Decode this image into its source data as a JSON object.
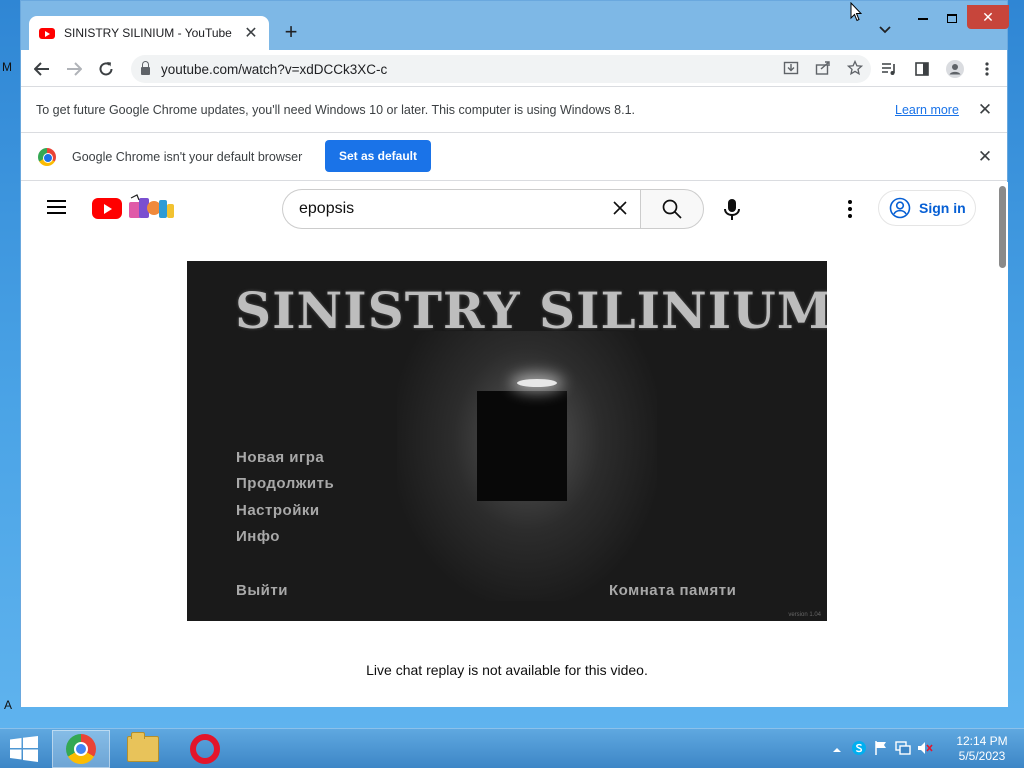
{
  "desktop": {
    "left_edge_letter_top": "M",
    "left_edge_letter_bottom": "A"
  },
  "browser": {
    "tab": {
      "title": "SINISTRY SILINIUM - YouTube",
      "close": "✕"
    },
    "new_tab": "+",
    "tab_search": "⌄",
    "window_controls": {
      "minimize": "—",
      "maximize": "☐",
      "close": "✕"
    },
    "toolbar": {
      "back": "←",
      "forward": "→",
      "reload": "↻",
      "url": "youtube.com/watch?v=xdDCCk3XC-c"
    },
    "update_bar": {
      "text": "To get future Google Chrome updates, you'll need Windows 10 or later. This computer is using Windows 8.1.",
      "learn_more": "Learn more",
      "close": "✕"
    },
    "default_bar": {
      "text": "Google Chrome isn't your default browser",
      "button": "Set as default",
      "close": "✕"
    }
  },
  "youtube": {
    "search": {
      "value": "epopsis",
      "clear": "✕"
    },
    "sign_in": "Sign in",
    "video": {
      "game_title": "SINISTRY SILINIUM",
      "menu": {
        "new_game": "Новая игра",
        "continue": "Продолжить",
        "settings": "Настройки",
        "info": "Инфо",
        "exit": "Выйти",
        "memory_room": "Комната памяти"
      },
      "version": "version 1.04"
    },
    "chat_note": "Live chat replay is not available for this video."
  },
  "taskbar": {
    "clock_time": "12:14 PM",
    "clock_date": "5/5/2023"
  },
  "colors": {
    "accent": "#1a73e8",
    "youtube_red": "#ff0000",
    "taskbar": "#3d86c6"
  }
}
